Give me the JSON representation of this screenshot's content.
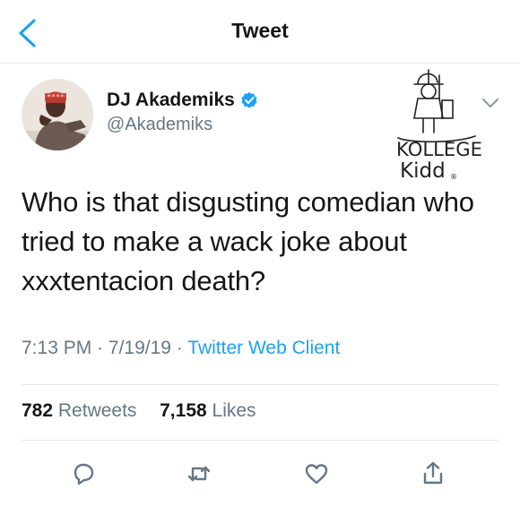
{
  "header": {
    "title": "Tweet",
    "back_icon": "chevron-left-icon"
  },
  "author": {
    "name": "DJ Akademiks",
    "handle": "@Akademiks",
    "verified": true,
    "avatar_badge": "★ ★ ★ ★"
  },
  "watermark": {
    "line1": "KOLLEGE",
    "line2": "Kidd",
    "mark": "®"
  },
  "tweet": {
    "text": "Who is that disgusting comedian who tried to make a wack joke about xxxtentacion death?",
    "time": "7:13 PM",
    "date": "7/19/19",
    "client": "Twitter Web Client",
    "separator": "·"
  },
  "stats": {
    "retweets_count": "782",
    "retweets_label": "Retweets",
    "likes_count": "7,158",
    "likes_label": "Likes"
  },
  "actions": [
    "reply-icon",
    "retweet-icon",
    "like-icon",
    "share-icon"
  ],
  "colors": {
    "accent": "#1da1f2",
    "secondary_text": "#657786",
    "divider": "#e1e8ed"
  }
}
